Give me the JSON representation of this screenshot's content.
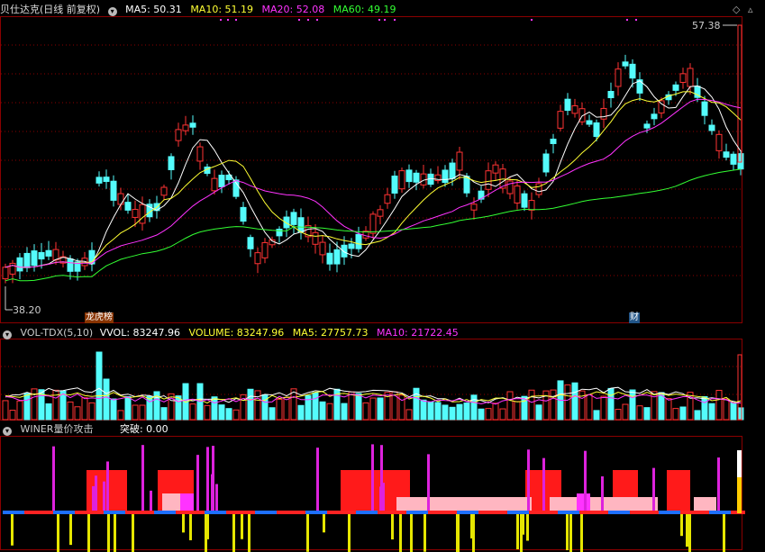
{
  "main_panel": {
    "title": "贝仕达克(日线 前复权)",
    "ma_labels": [
      {
        "text": "MA5: 50.31",
        "color": "#ffffff"
      },
      {
        "text": "MA10: 51.19",
        "color": "#ffff33"
      },
      {
        "text": "MA20: 52.08",
        "color": "#ff33ff"
      },
      {
        "text": "MA60: 49.19",
        "color": "#33ff33"
      }
    ],
    "high_label": "57.38",
    "low_label": "38.20",
    "event_left": "龙虎榜",
    "event_right": "财"
  },
  "vol_panel": {
    "title": "VOL-TDX(5,10)",
    "labels": [
      {
        "text": "VVOL: 83247.96",
        "color": "#ffffff"
      },
      {
        "text": "VOLUME: 83247.96",
        "color": "#ffff33"
      },
      {
        "text": "MA5: 27757.73",
        "color": "#ffff33"
      },
      {
        "text": "MA10: 21722.45",
        "color": "#ff33ff"
      }
    ]
  },
  "winer_panel": {
    "title": "WINER量价攻击",
    "label": "突破: 0.00"
  },
  "colors": {
    "up": "#ff3333",
    "down": "#54fcfc",
    "grid": "#8b0000",
    "bg": "#000000"
  }
}
